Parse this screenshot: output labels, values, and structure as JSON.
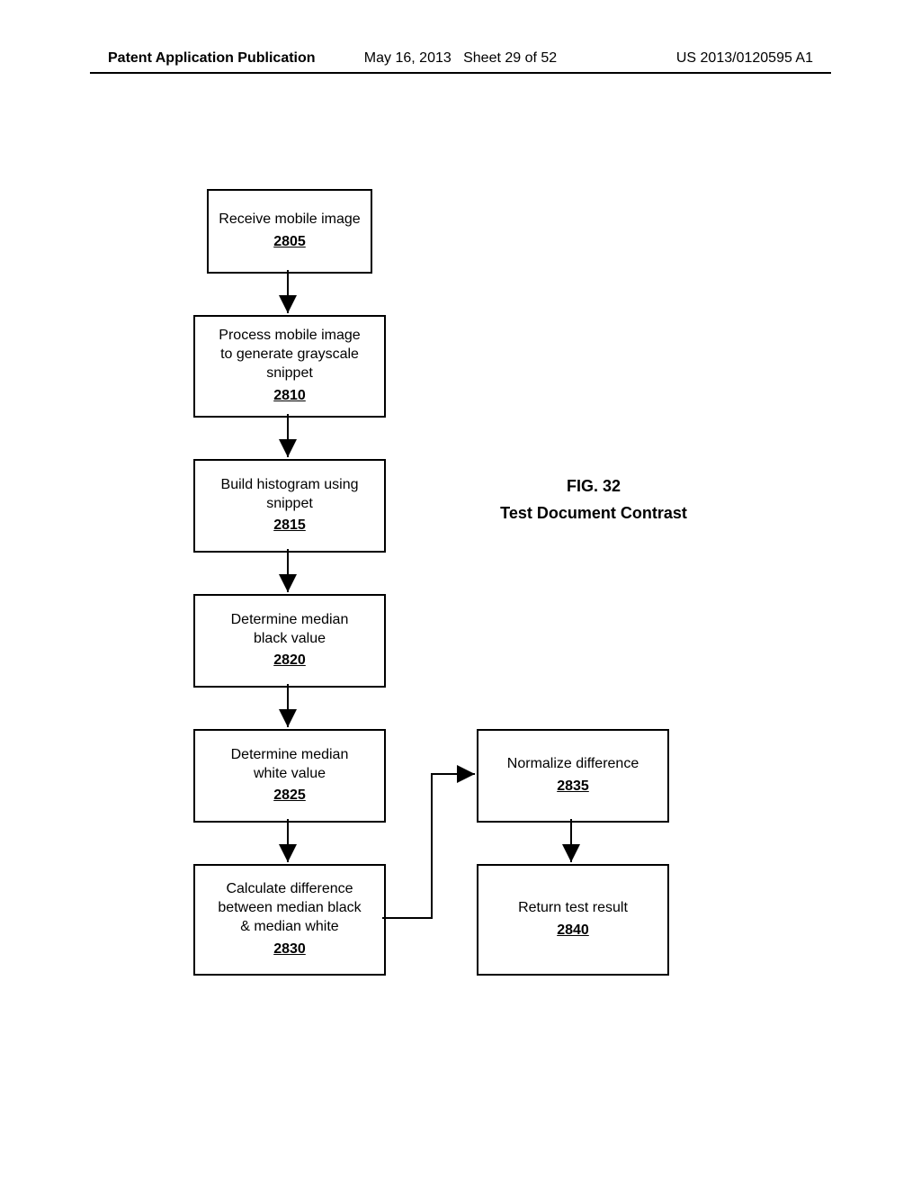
{
  "header": {
    "left": "Patent Application Publication",
    "date": "May 16, 2013",
    "sheet": "Sheet 29 of 52",
    "pubno": "US 2013/0120595 A1"
  },
  "figure": {
    "label": "FIG. 32",
    "title": "Test Document Contrast"
  },
  "boxes": {
    "b2805": {
      "text": "Receive mobile image",
      "num": "2805"
    },
    "b2810": {
      "text1": "Process mobile image",
      "text2": "to generate grayscale",
      "text3": "snippet",
      "num": "2810"
    },
    "b2815": {
      "text1": "Build histogram using",
      "text2": "snippet",
      "num": "2815"
    },
    "b2820": {
      "text1": "Determine median",
      "text2": "black value",
      "num": "2820"
    },
    "b2825": {
      "text1": "Determine median",
      "text2": "white value",
      "num": "2825"
    },
    "b2830": {
      "text1": "Calculate difference",
      "text2": "between median black",
      "text3": "& median white",
      "num": "2830"
    },
    "b2835": {
      "text": "Normalize difference",
      "num": "2835"
    },
    "b2840": {
      "text": "Return test result",
      "num": "2840"
    }
  },
  "chart_data": {
    "type": "flowchart",
    "nodes": [
      {
        "id": "2805",
        "label": "Receive mobile image"
      },
      {
        "id": "2810",
        "label": "Process mobile image to generate grayscale snippet"
      },
      {
        "id": "2815",
        "label": "Build histogram using snippet"
      },
      {
        "id": "2820",
        "label": "Determine median black value"
      },
      {
        "id": "2825",
        "label": "Determine median white value"
      },
      {
        "id": "2830",
        "label": "Calculate difference between median black & median white"
      },
      {
        "id": "2835",
        "label": "Normalize difference"
      },
      {
        "id": "2840",
        "label": "Return test result"
      }
    ],
    "edges": [
      [
        "2805",
        "2810"
      ],
      [
        "2810",
        "2815"
      ],
      [
        "2815",
        "2820"
      ],
      [
        "2820",
        "2825"
      ],
      [
        "2825",
        "2830"
      ],
      [
        "2830",
        "2835"
      ],
      [
        "2835",
        "2840"
      ]
    ],
    "title": "Test Document Contrast",
    "figure": "FIG. 32"
  }
}
